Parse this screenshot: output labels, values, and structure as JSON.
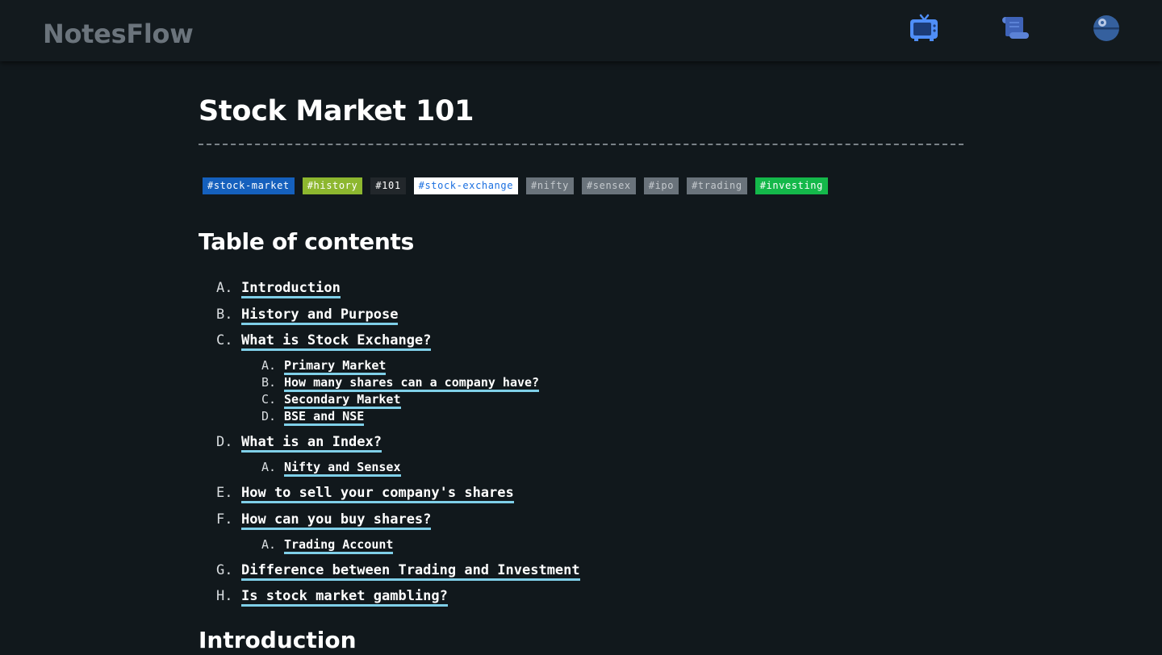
{
  "app": {
    "brand": "NotesFlow"
  },
  "nav": {
    "icons": [
      {
        "name": "tv-icon",
        "color": "#4f8ef7"
      },
      {
        "name": "scroll-icon",
        "color": "#3f63b8"
      },
      {
        "name": "death-star-icon",
        "color": "#35609e"
      }
    ]
  },
  "page": {
    "title": "Stock Market 101",
    "tags": [
      {
        "label": "#stock-market",
        "bg": "#1560bd",
        "fg": "#ffffff"
      },
      {
        "label": "#history",
        "bg": "#8db72f",
        "fg": "#ffffff"
      },
      {
        "label": "#101",
        "bg": "#22272b",
        "fg": "#ffffff"
      },
      {
        "label": "#stock-exchange",
        "bg": "#ffffff",
        "fg": "#1a6fe0"
      },
      {
        "label": "#nifty",
        "bg": "#6a737b",
        "fg": "#c5cace"
      },
      {
        "label": "#sensex",
        "bg": "#6a737b",
        "fg": "#c5cace"
      },
      {
        "label": "#ipo",
        "bg": "#6a737b",
        "fg": "#c5cace"
      },
      {
        "label": "#trading",
        "bg": "#6a737b",
        "fg": "#c5cace"
      },
      {
        "label": "#investing",
        "bg": "#14b84a",
        "fg": "#ffffff"
      }
    ],
    "toc_heading": "Table of contents",
    "toc": [
      {
        "marker": "A.",
        "label": "Introduction",
        "children": []
      },
      {
        "marker": "B.",
        "label": "History and Purpose",
        "children": []
      },
      {
        "marker": "C.",
        "label": "What is Stock Exchange?",
        "children": [
          {
            "marker": "A.",
            "label": "Primary Market"
          },
          {
            "marker": "B.",
            "label": "How many shares can a company have?"
          },
          {
            "marker": "C.",
            "label": "Secondary Market"
          },
          {
            "marker": "D.",
            "label": "BSE and NSE"
          }
        ]
      },
      {
        "marker": "D.",
        "label": "What is an Index?",
        "children": [
          {
            "marker": "A.",
            "label": "Nifty and Sensex"
          }
        ]
      },
      {
        "marker": "E.",
        "label": "How to sell your company's shares",
        "children": []
      },
      {
        "marker": "F.",
        "label": "How can you buy shares?",
        "children": [
          {
            "marker": "A.",
            "label": "Trading Account"
          }
        ]
      },
      {
        "marker": "G.",
        "label": "Difference between Trading and Investment",
        "children": []
      },
      {
        "marker": "H.",
        "label": "Is stock market gambling?",
        "children": []
      }
    ],
    "next_heading": "Introduction"
  },
  "colors": {
    "background": "#11181c",
    "link_underline": "#7fcfe8"
  }
}
